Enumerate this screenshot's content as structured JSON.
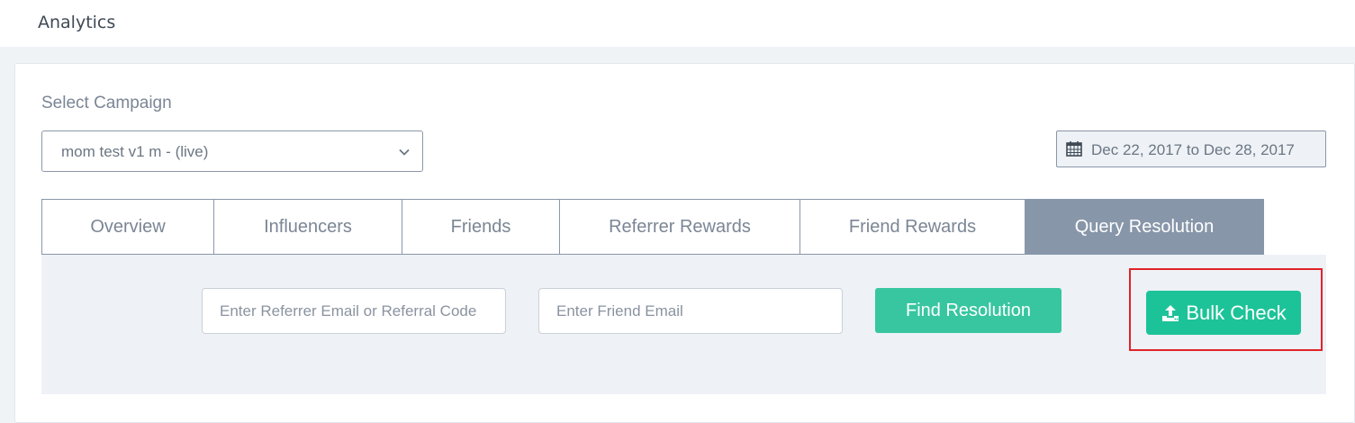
{
  "header": {
    "title": "Analytics"
  },
  "campaign": {
    "label": "Select Campaign",
    "selected": "mom test v1 m - (live)"
  },
  "date_range": {
    "text": "Dec 22, 2017 to Dec 28, 2017"
  },
  "tabs": [
    {
      "label": "Overview",
      "active": false
    },
    {
      "label": "Influencers",
      "active": false
    },
    {
      "label": "Friends",
      "active": false
    },
    {
      "label": "Referrer Rewards",
      "active": false
    },
    {
      "label": "Friend Rewards",
      "active": false
    },
    {
      "label": "Query Resolution",
      "active": true
    }
  ],
  "query": {
    "referrer_placeholder": "Enter Referrer Email or Referral Code",
    "friend_placeholder": "Enter Friend Email",
    "find_label": "Find Resolution",
    "bulk_label": "Bulk Check"
  },
  "colors": {
    "accent": "#37c6a0",
    "bulk": "#1dc398",
    "active_tab": "#8896a9",
    "highlight": "#e0242a"
  }
}
